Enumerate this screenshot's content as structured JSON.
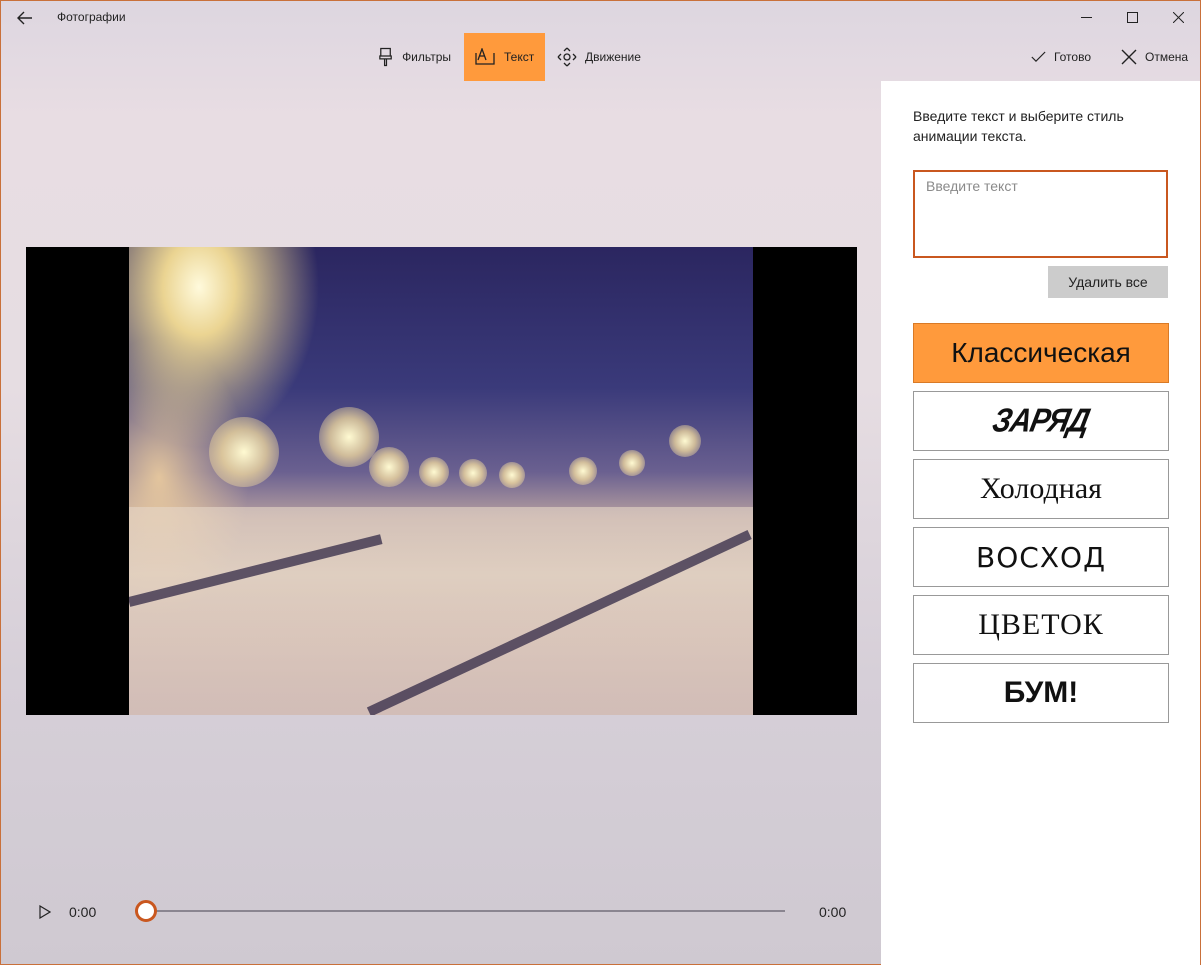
{
  "window": {
    "app_title": "Фотографии",
    "back_icon": "arrow-left-icon",
    "controls": [
      "minimize-icon",
      "maximize-icon",
      "close-icon"
    ]
  },
  "toolbar": {
    "filters_label": "Фильтры",
    "text_label": "Текст",
    "motion_label": "Движение",
    "done_label": "Готово",
    "cancel_label": "Отмена",
    "active_tab": "text"
  },
  "player": {
    "current_time": "0:00",
    "total_time": "0:00",
    "progress": 0
  },
  "panel": {
    "instruction": "Введите текст и выберите стиль анимации текста.",
    "input_placeholder": "Введите текст",
    "input_value": "",
    "delete_all_label": "Удалить все",
    "styles": [
      {
        "label": "Классическая",
        "selected": true
      },
      {
        "label": "ЗАРЯД",
        "selected": false
      },
      {
        "label": "Холодная",
        "selected": false
      },
      {
        "label": "ВОСХОД",
        "selected": false
      },
      {
        "label": "ЦВЕТОК",
        "selected": false
      },
      {
        "label": "БУМ!",
        "selected": false
      }
    ]
  },
  "colors": {
    "accent": "#ff9a3c",
    "accent_border": "#c9571f"
  }
}
